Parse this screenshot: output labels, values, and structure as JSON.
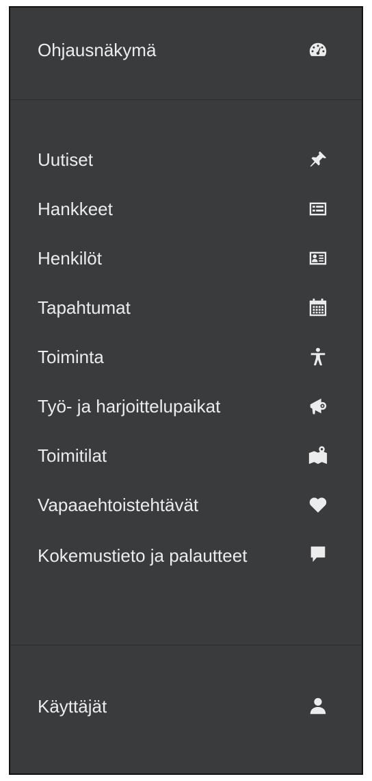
{
  "menu": {
    "top": {
      "label": "Ohjausnäkymä",
      "icon": "dashboard-icon"
    },
    "items": [
      {
        "label": "Uutiset",
        "icon": "pin-icon"
      },
      {
        "label": "Hankkeet",
        "icon": "list-card-icon"
      },
      {
        "label": "Henkilöt",
        "icon": "id-card-icon"
      },
      {
        "label": "Tapahtumat",
        "icon": "calendar-icon"
      },
      {
        "label": "Toiminta",
        "icon": "accessibility-icon"
      },
      {
        "label": "Työ- ja harjoittelupaikat",
        "icon": "megaphone-icon"
      },
      {
        "label": "Toimitilat",
        "icon": "map-pin-icon"
      },
      {
        "label": "Vapaaehtoistehtävät",
        "icon": "heart-icon"
      },
      {
        "label": "Kokemustieto ja palautteet",
        "icon": "comment-icon"
      }
    ],
    "bottom": {
      "label": "Käyttäjät",
      "icon": "user-icon"
    }
  },
  "colors": {
    "background": "#3a3b3d",
    "text": "#ececec",
    "divider": "#2a2b2c",
    "border": "#111111"
  }
}
